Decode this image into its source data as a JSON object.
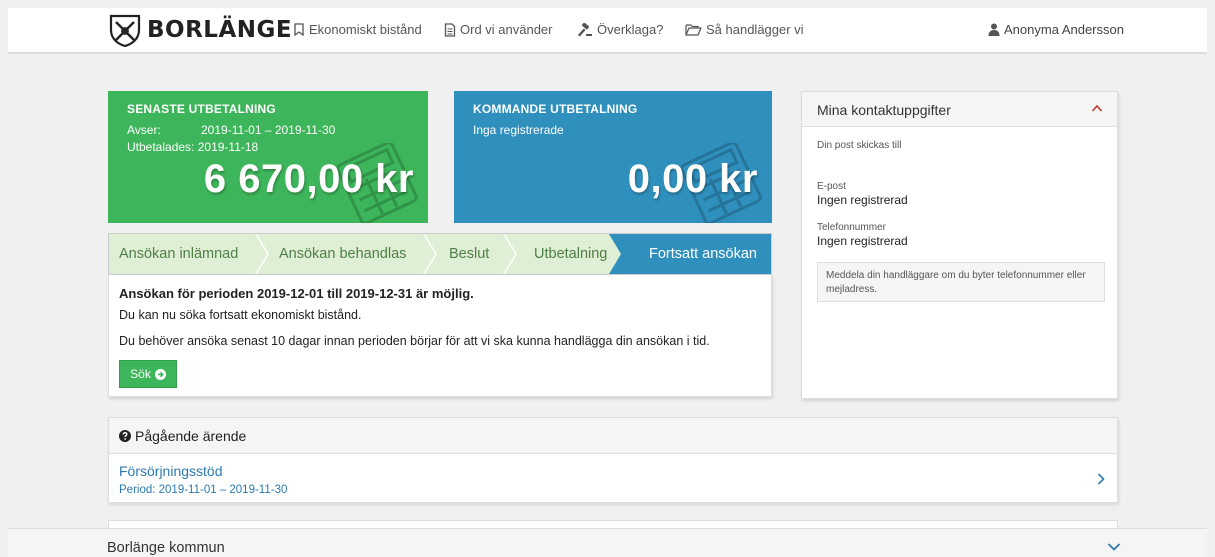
{
  "header": {
    "brand": "BORLÄNGE",
    "nav": [
      {
        "label": "Ekonomiskt bistånd",
        "icon": "bookmark-icon"
      },
      {
        "label": "Ord vi använder",
        "icon": "document-icon"
      },
      {
        "label": "Överklaga?",
        "icon": "gavel-icon"
      },
      {
        "label": "Så handlägger vi",
        "icon": "folder-open-icon"
      }
    ],
    "user": "Anonyma Andersson"
  },
  "latest_payment": {
    "title": "SENASTE UTBETALNING",
    "avser_label": "Avser:",
    "avser_value": "2019-11-01 – 2019-11-30",
    "paid_label": "Utbetalades:",
    "paid_value": "2019-11-18",
    "amount": "6 670,00 kr"
  },
  "next_payment": {
    "title": "KOMMANDE UTBETALNING",
    "status": "Inga registrerade",
    "amount": "0,00 kr"
  },
  "steps": {
    "items": [
      "Ansökan inlämnad",
      "Ansökan behandlas",
      "Beslut",
      "Utbetalning"
    ],
    "active": "Fortsatt ansökan"
  },
  "application": {
    "heading": "Ansökan för perioden 2019-12-01 till 2019-12-31 är möjlig.",
    "line1": "Du kan nu söka fortsatt ekonomiskt bistånd.",
    "line2": "Du behöver ansöka senast 10 dagar innan perioden börjar för att vi ska kunna handlägga din ansökan i tid.",
    "button": "Sök"
  },
  "contact": {
    "title": "Mina kontaktuppgifter",
    "mail_to": "Din post skickas till",
    "email_label": "E-post",
    "email_value": "Ingen registrerad",
    "phone_label": "Telefonnummer",
    "phone_value": "Ingen registrerad",
    "note": "Meddela din handläggare om du byter telefonnummer eller mejladress."
  },
  "ongoing": {
    "title": "Pågående ärende",
    "case_name": "Försörjningsstöd",
    "case_period": "Period: 2019-11-01 – 2019-11-30"
  },
  "footer": {
    "title": "Borlänge kommun"
  },
  "colors": {
    "green": "#3db55a",
    "blue": "#2f8fbd",
    "link": "#2a7ab0",
    "step_bg": "#dfefd6"
  }
}
